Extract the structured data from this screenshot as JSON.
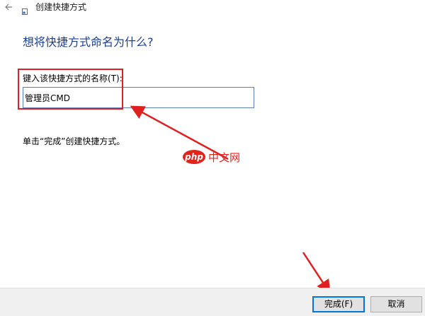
{
  "window": {
    "title": "创建快捷方式"
  },
  "main": {
    "heading": "想将快捷方式命名为什么?",
    "field_label": "键入该快捷方式的名称(T):",
    "name_value": "管理员CMD",
    "hint": "单击“完成”创建快捷方式。"
  },
  "watermark": {
    "badge": "php",
    "text": "中文网"
  },
  "buttons": {
    "finish": "完成(F)",
    "cancel": "取消"
  },
  "colors": {
    "heading": "#1c3f94",
    "annotation": "#e02020",
    "primary_border": "#0078d7"
  },
  "icons": {
    "back": "back-arrow-icon",
    "app": "shortcut-app-icon"
  }
}
